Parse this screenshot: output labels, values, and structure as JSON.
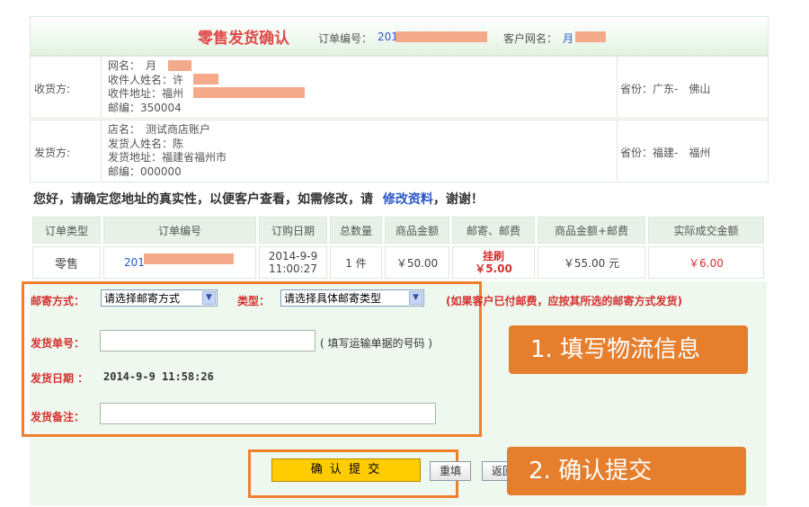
{
  "header": {
    "title": "零售发货确认",
    "order_no_label": "订单编号：",
    "order_no": "201",
    "customer_label": "客户网名：",
    "customer": "月"
  },
  "receiver": {
    "section_label": "收货方:",
    "lines": [
      "网名：　月",
      "收件人姓名：许",
      "收件地址：福州",
      "邮编：350004"
    ],
    "province": "省份：广东-　佛山"
  },
  "sender": {
    "section_label": "发货方:",
    "lines": [
      "店名：　测试商店账户",
      "发货人姓名：陈",
      "发货地址：福建省福州市",
      "邮编：000000"
    ],
    "province": "省份：福建-　福州"
  },
  "notice": {
    "text": "您好，请确定您地址的真实性，以便客户查看，如需修改，请",
    "link": "修改资料",
    "suffix": "，谢谢！"
  },
  "order_table": {
    "headers": [
      "订单类型",
      "订单编号",
      "订购日期",
      "总数量",
      "商品金额",
      "邮寄、邮费",
      "商品金额+邮费",
      "实际成交金额"
    ],
    "row": {
      "type": "零售",
      "order_no": "201",
      "date": "2014-9-9",
      "time": "11:00:27",
      "qty": "1 件",
      "amount": "￥50.00",
      "shipping_method": "挂刷",
      "shipping_fee": "￥5.00",
      "total": "￥55.00 元",
      "actual": "￥6.00"
    }
  },
  "form": {
    "mail_method_label": "邮寄方式：",
    "mail_method_value": "请选择邮寄方式",
    "type_label": "类型：",
    "type_value": "请选择具体邮寄类型",
    "paid_hint": "(如果客户已付邮费，应按其所选的邮寄方式发货)",
    "tracking_label": "发货单号：",
    "tracking_value": "",
    "tracking_hint": "( 填写运输单据的号码 )",
    "ship_date_label": "发货日期 ：",
    "ship_date_value": "2014-9-9 11:58:26",
    "remark_label": "发货备注：",
    "remark_value": ""
  },
  "buttons": {
    "confirm": "确 认 提 交",
    "reset": "重填",
    "back": "返回"
  },
  "callouts": {
    "step1": "1. 填写物流信息",
    "step2": "2. 确认提交"
  },
  "colors": {
    "accent_orange": "#e57f2e",
    "title_red": "#e04848",
    "label_red": "#d43030",
    "link_blue": "#2a57c8",
    "button_yellow": "#ffcc00"
  }
}
